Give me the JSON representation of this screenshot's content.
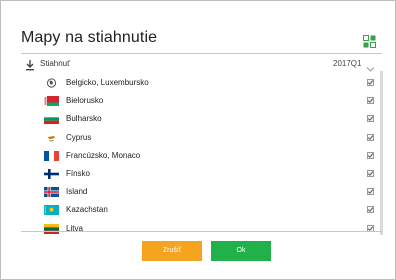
{
  "dialog": {
    "title": "Mapy na stiahnutie"
  },
  "list_header": {
    "label": "Stiahnuť",
    "version": "2017Q1"
  },
  "items": [
    {
      "label": "Belgicko, Luxembursko",
      "flag": "globe",
      "checked": true
    },
    {
      "label": "Bielorusko",
      "flag": "belarus",
      "checked": true
    },
    {
      "label": "Bulharsko",
      "flag": "bulgaria",
      "checked": true
    },
    {
      "label": "Cyprus",
      "flag": "cyprus",
      "checked": true
    },
    {
      "label": "Francúzsko, Monaco",
      "flag": "france",
      "checked": true
    },
    {
      "label": "Fínsko",
      "flag": "finland",
      "checked": true
    },
    {
      "label": "Island",
      "flag": "iceland",
      "checked": true
    },
    {
      "label": "Kazachstan",
      "flag": "kazakhstan",
      "checked": true
    },
    {
      "label": "Litva",
      "flag": "lithuania",
      "checked": true
    }
  ],
  "buttons": {
    "cancel": "Zrušiť",
    "ok": "Ok"
  },
  "colors": {
    "cancel": "#f5a41f",
    "ok": "#21b14b",
    "accent_icon": "#3aa14a"
  }
}
